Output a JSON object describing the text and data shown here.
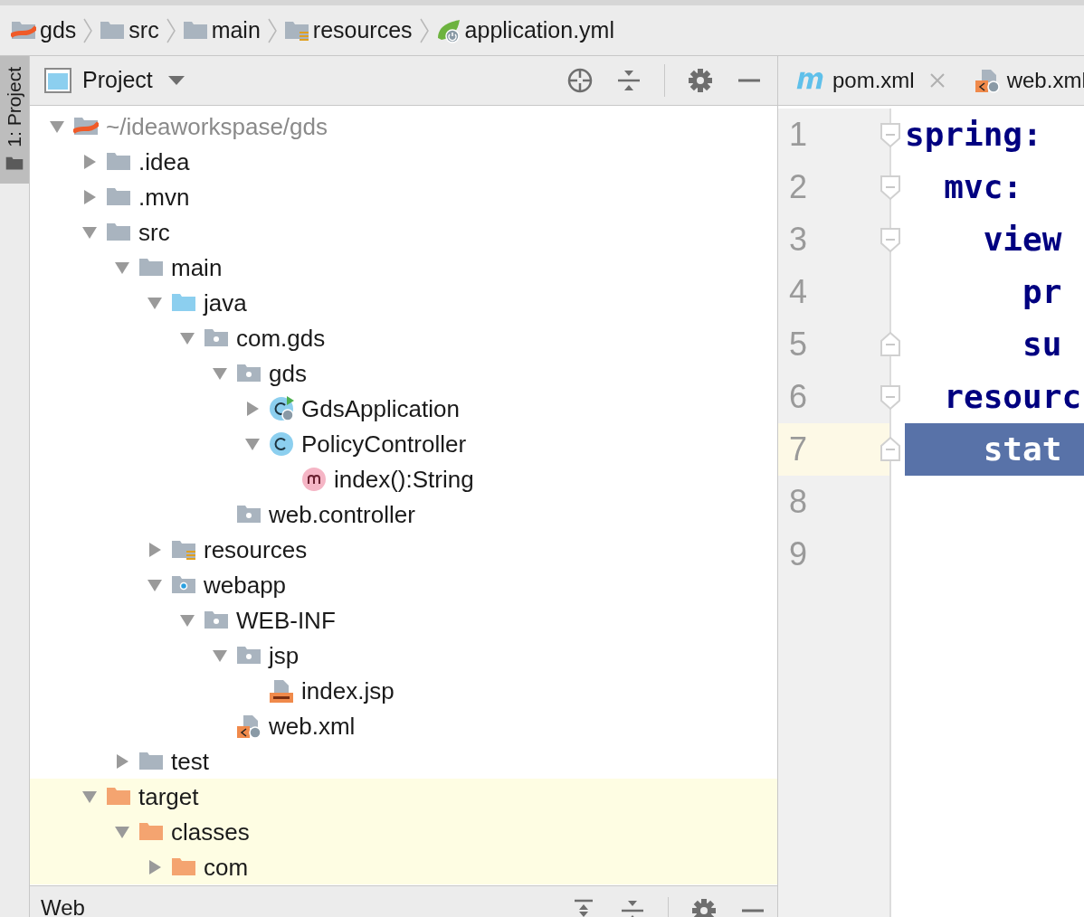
{
  "breadcrumbs": [
    {
      "label": "gds",
      "kind": "module"
    },
    {
      "label": "src",
      "kind": "folder"
    },
    {
      "label": "main",
      "kind": "folder"
    },
    {
      "label": "resources",
      "kind": "resources-folder"
    },
    {
      "label": "application.yml",
      "kind": "spring-file"
    }
  ],
  "side_tabs": [
    {
      "label": "1: Project",
      "selected": true
    }
  ],
  "project_panel": {
    "title": "Project",
    "tree": [
      {
        "label": "~/ideaworkspase/gds",
        "kind": "module",
        "expanded": true,
        "children": [
          {
            "label": ".idea",
            "kind": "folder",
            "expanded": false
          },
          {
            "label": ".mvn",
            "kind": "folder",
            "expanded": false
          },
          {
            "label": "src",
            "kind": "folder",
            "expanded": true,
            "children": [
              {
                "label": "main",
                "kind": "folder",
                "expanded": true,
                "children": [
                  {
                    "label": "java",
                    "kind": "source-folder",
                    "expanded": true,
                    "children": [
                      {
                        "label": "com.gds",
                        "kind": "package",
                        "expanded": true,
                        "children": [
                          {
                            "label": "gds",
                            "kind": "package",
                            "expanded": true,
                            "children": [
                              {
                                "label": "GdsApplication",
                                "kind": "run-class",
                                "expanded": false
                              },
                              {
                                "label": "PolicyController",
                                "kind": "class",
                                "expanded": true,
                                "children": [
                                  {
                                    "label": "index():String",
                                    "kind": "method"
                                  }
                                ]
                              }
                            ]
                          },
                          {
                            "label": "web.controller",
                            "kind": "package"
                          }
                        ]
                      }
                    ]
                  },
                  {
                    "label": "resources",
                    "kind": "resources-folder",
                    "expanded": false
                  },
                  {
                    "label": "webapp",
                    "kind": "webapp-folder",
                    "expanded": true,
                    "children": [
                      {
                        "label": "WEB-INF",
                        "kind": "package",
                        "expanded": true,
                        "children": [
                          {
                            "label": "jsp",
                            "kind": "package",
                            "expanded": true,
                            "children": [
                              {
                                "label": "index.jsp",
                                "kind": "jsp"
                              }
                            ]
                          },
                          {
                            "label": "web.xml",
                            "kind": "xml"
                          }
                        ]
                      }
                    ]
                  }
                ]
              },
              {
                "label": "test",
                "kind": "folder",
                "expanded": false
              }
            ]
          },
          {
            "label": "target",
            "kind": "excluded-folder",
            "expanded": true,
            "children": [
              {
                "label": "classes",
                "kind": "excluded-folder",
                "expanded": true,
                "children": [
                  {
                    "label": "com",
                    "kind": "excluded-folder",
                    "expanded": false
                  }
                ]
              }
            ]
          }
        ]
      }
    ]
  },
  "bottom_panel": {
    "title": "Web"
  },
  "editor": {
    "tabs": [
      {
        "label": "pom.xml",
        "kind": "maven",
        "selected": false,
        "closable": true
      },
      {
        "label": "web.xml",
        "kind": "xml",
        "selected": false
      }
    ],
    "lines": [
      {
        "number": "1",
        "code": "spring:",
        "kind": "fold-start",
        "selected": false
      },
      {
        "number": "2",
        "code": "  mvc:",
        "kind": "fold-start",
        "selected": false
      },
      {
        "number": "3",
        "code": "    view",
        "kind": "fold-start",
        "selected": false
      },
      {
        "number": "4",
        "code": "      pr",
        "kind": "plain",
        "selected": false
      },
      {
        "number": "5",
        "code": "      su",
        "kind": "fold-end",
        "selected": false
      },
      {
        "number": "6",
        "code": "  resourc",
        "kind": "fold-start",
        "selected": false
      },
      {
        "number": "7",
        "code": "    stat",
        "kind": "fold-end",
        "selected": true
      },
      {
        "number": "8",
        "kind": "plain",
        "selected": false
      },
      {
        "number": "9",
        "kind": "plain",
        "selected": false
      }
    ]
  }
}
